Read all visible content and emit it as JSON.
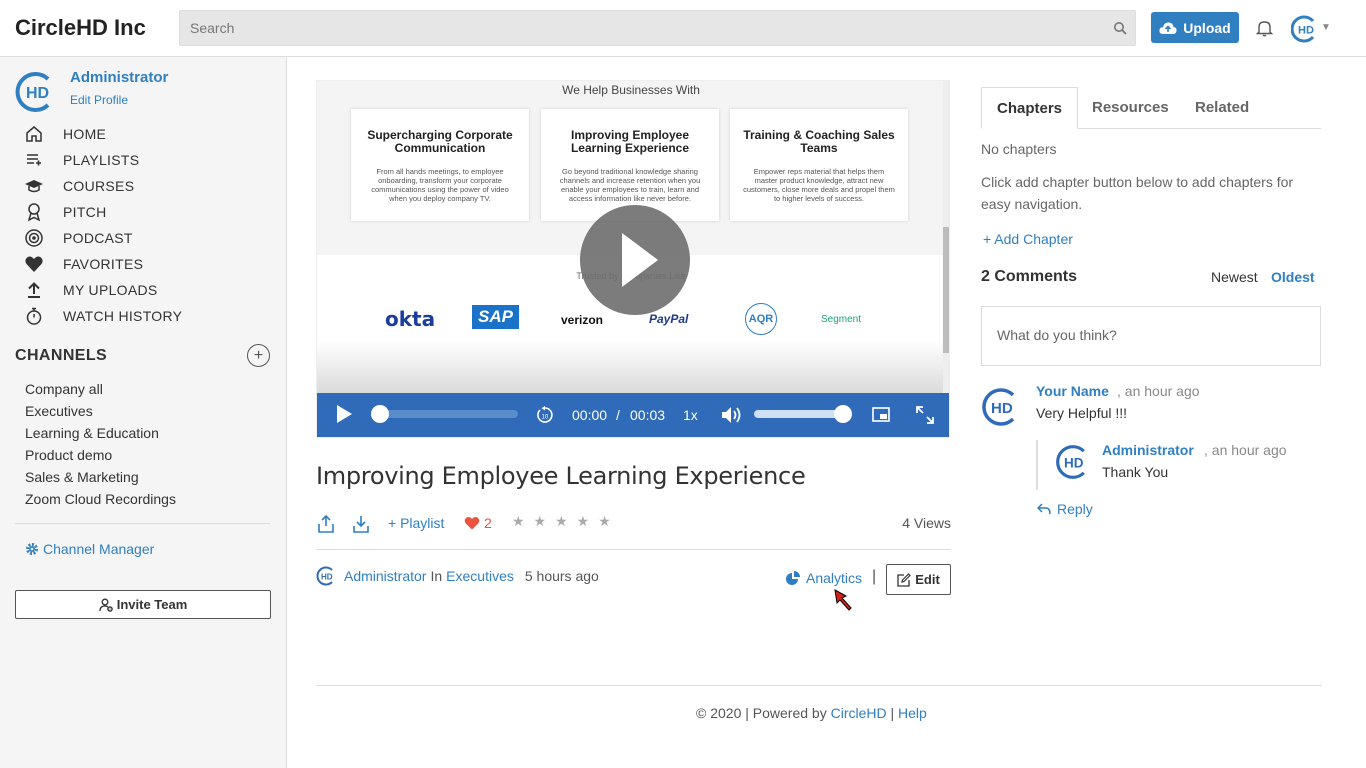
{
  "header": {
    "brand": "CircleHD Inc",
    "search_placeholder": "Search",
    "upload_label": "Upload"
  },
  "profile": {
    "name": "Administrator",
    "edit_label": "Edit Profile"
  },
  "nav": {
    "items": [
      {
        "label": "HOME",
        "icon": "home-icon"
      },
      {
        "label": "PLAYLISTS",
        "icon": "playlist-icon"
      },
      {
        "label": "COURSES",
        "icon": "graduation-cap-icon"
      },
      {
        "label": "PITCH",
        "icon": "award-icon"
      },
      {
        "label": "PODCAST",
        "icon": "podcast-icon"
      },
      {
        "label": "FAVORITES",
        "icon": "heart-icon"
      },
      {
        "label": "MY UPLOADS",
        "icon": "upload-icon"
      },
      {
        "label": "WATCH HISTORY",
        "icon": "stopwatch-icon"
      }
    ]
  },
  "channels": {
    "title": "CHANNELS",
    "items": [
      "Company all",
      "Executives",
      "Learning & Education",
      "Product demo",
      "Sales & Marketing",
      "Zoom Cloud Recordings"
    ],
    "manager_label": "Channel Manager",
    "invite_label": "Invite Team"
  },
  "video": {
    "heading": "We Help Businesses With",
    "cards": [
      {
        "title": "Supercharging Corporate Communication",
        "text": "From all hands meetings, to employee onboarding, transform your corporate communications using the power of video when you deploy company TV."
      },
      {
        "title": "Improving Employee Learning Experience",
        "text": "Go beyond traditional knowledge sharing channels and increase retention when you enable your employees to train, learn and access information like never before."
      },
      {
        "title": "Training & Coaching Sales Teams",
        "text": "Empower reps material that helps them master product knowledge, attract new customers, close more deals and propel them to higher levels of success."
      }
    ],
    "trusted": "Trusted by Companies Like",
    "logos": [
      "okta",
      "SAP",
      "verizon",
      "PayPal",
      "AQR",
      "Segment"
    ],
    "current_time": "00:00",
    "time_sep": "/",
    "duration": "00:03",
    "speed": "1x",
    "progress_fraction": 0.0,
    "volume_fraction": 1.0
  },
  "details": {
    "title": "Improving Employee Learning Experience",
    "playlist_label": "+ Playlist",
    "likes": "2",
    "stars": "★★★★★",
    "views": "4 Views",
    "author": "Administrator",
    "in_label": "In",
    "channel": "Executives",
    "posted": "5 hours ago",
    "analytics_label": "Analytics",
    "separator": "|",
    "edit_label": "Edit"
  },
  "footer": {
    "copyright": "© 2020 | Powered by",
    "brand_link": "CircleHD",
    "separator": "|",
    "help_link": "Help"
  },
  "panel": {
    "tabs": [
      "Chapters",
      "Resources",
      "Related"
    ],
    "no_chapters": "No chapters",
    "chapters_help": "Click add chapter button below to add chapters for easy navigation.",
    "add_chapter": "+ Add Chapter",
    "comments_title": "2 Comments",
    "sort_newest": "Newest",
    "sort_oldest": "Oldest",
    "comment_placeholder": "What do you think?",
    "comments": [
      {
        "author": "Your Name",
        "time": "an hour ago",
        "text": "Very Helpful !!!"
      },
      {
        "author": "Administrator",
        "time": "an hour ago",
        "text": "Thank You"
      }
    ],
    "reply_label": "Reply"
  },
  "colors": {
    "accent": "#2f7fc1",
    "player_bar": "#2f6bb8",
    "like": "#e8543f"
  }
}
